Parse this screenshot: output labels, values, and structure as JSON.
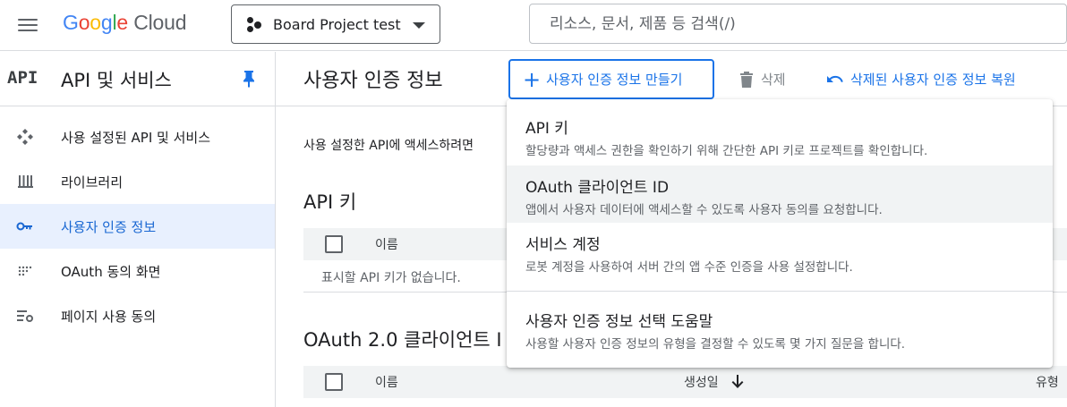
{
  "topbar": {
    "logo_google": "Google",
    "logo_cloud": "Cloud",
    "project_name": "Board Project test",
    "search_placeholder": "리소스, 문서, 제품 등 검색(/)"
  },
  "sidebar": {
    "api_badge": "API",
    "title": "API 및 서비스",
    "items": [
      {
        "label": "사용 설정된 API 및 서비스",
        "icon": "enabled-apis-icon"
      },
      {
        "label": "라이브러리",
        "icon": "library-icon"
      },
      {
        "label": "사용자 인증 정보",
        "icon": "key-icon",
        "active": true
      },
      {
        "label": "OAuth 동의 화면",
        "icon": "oauth-consent-icon"
      },
      {
        "label": "페이지 사용 동의",
        "icon": "page-usage-icon"
      }
    ]
  },
  "main": {
    "title": "사용자 인증 정보",
    "create_label": "사용자 인증 정보 만들기",
    "delete_label": "삭제",
    "restore_label": "삭제된 사용자 인증 정보 복원",
    "description": "사용 설정한 API에 액세스하려면",
    "api_keys_title": "API 키",
    "api_keys_col_name": "이름",
    "api_keys_empty": "표시할 API 키가 없습니다.",
    "oauth_title": "OAuth 2.0 클라이언트 I",
    "oauth_col_name": "이름",
    "oauth_col_created": "생성일",
    "oauth_col_type": "유형"
  },
  "menu": {
    "items": [
      {
        "title": "API 키",
        "subtitle": "할당량과 액세스 권한을 확인하기 위해 간단한 API 키로 프로젝트를 확인합니다."
      },
      {
        "title": "OAuth 클라이언트 ID",
        "subtitle": "앱에서 사용자 데이터에 액세스할 수 있도록 사용자 동의를 요청합니다.",
        "highlighted": true
      },
      {
        "title": "서비스 계정",
        "subtitle": "로봇 계정을 사용하여 서버 간의 앱 수준 인증을 사용 설정합니다."
      },
      {
        "title": "사용자 인증 정보 선택 도움말",
        "subtitle": "사용할 사용자 인증 정보의 유형을 결정할 수 있도록 몇 가지 질문을 합니다."
      }
    ]
  },
  "colors": {
    "accent": "#1a73e8",
    "active_bg": "#e8f0fe",
    "active_text": "#1967d2"
  }
}
